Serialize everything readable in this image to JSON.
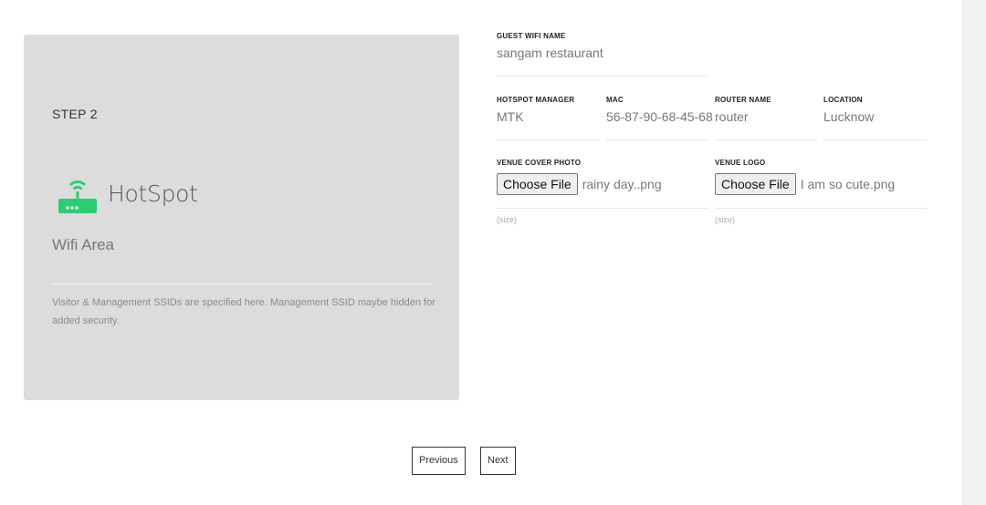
{
  "card": {
    "step": "STEP 2",
    "logo_text": "HotSpot",
    "logo_icon": "wifi-router-icon",
    "title": "Wifi Area",
    "description": "Visitor & Management SSIDs are specified here. Management SSID maybe hidden for added security."
  },
  "form": {
    "guest_wifi": {
      "label": "GUEST WIFI NAME",
      "value": "sangam restaurant"
    },
    "hotspot_manager": {
      "label": "HOTSPOT MANAGER",
      "value": "MTK"
    },
    "mac": {
      "label": "MAC",
      "value": "56-87-90-68-45-68"
    },
    "router_name": {
      "label": "ROUTER NAME",
      "value": "router"
    },
    "location": {
      "label": "LOCATION",
      "value": "Lucknow"
    },
    "cover_photo": {
      "label": "VENUE COVER PHOTO",
      "button": "Choose File",
      "file": "rainy day..png",
      "hint": "(size)"
    },
    "logo": {
      "label": "VENUE LOGO",
      "button": "Choose File",
      "file": "I am so cute.png",
      "hint": "(size)"
    }
  },
  "nav": {
    "previous": "Previous",
    "next": "Next"
  },
  "colors": {
    "accent": "#2ecc71",
    "card_bg": "#dcdcdc"
  }
}
